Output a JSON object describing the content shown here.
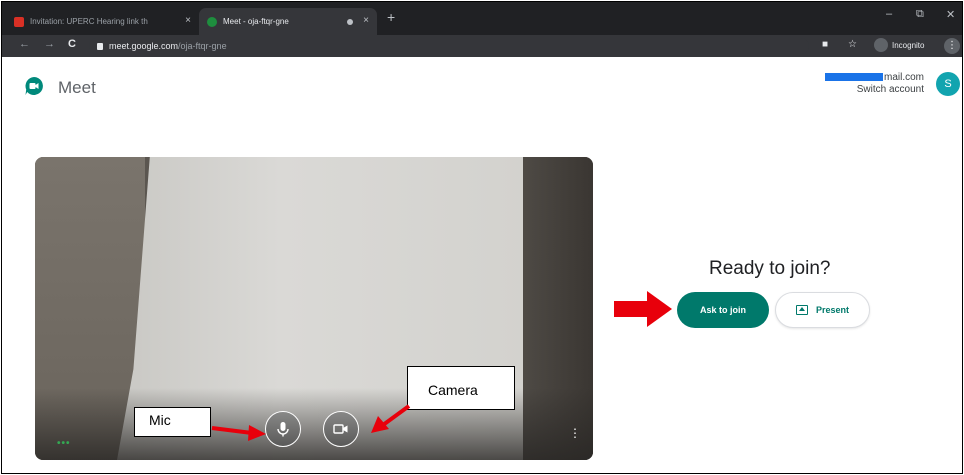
{
  "browser": {
    "tabs": [
      {
        "title": "Invitation: UPERC Hearing link th",
        "close": "×"
      },
      {
        "title": "Meet - oja-ftqr-gne",
        "close": "×"
      }
    ],
    "new_tab": "+",
    "window_controls": {
      "minimize": "–",
      "restore": "⧉",
      "close": "✕"
    },
    "nav": {
      "back": "←",
      "forward": "→",
      "reload": "C"
    },
    "url": {
      "host": "meet.google.com",
      "path": "/oja-ftqr-gne"
    },
    "icons": {
      "camera": "■",
      "star": "☆"
    },
    "incognito_label": "Incognito",
    "menu": "⋮"
  },
  "meet": {
    "app_name": "Meet",
    "account": {
      "email_visible": "mail.com",
      "switch_account": "Switch account",
      "avatar_letter": "S"
    },
    "ready_heading": "Ready to join?",
    "ask_to_join": "Ask to join",
    "present": "Present",
    "video_more": "⋮",
    "video_dots": "•••"
  },
  "annotations": {
    "mic": "Mic",
    "camera": "Camera"
  },
  "colors": {
    "accent": "#00796b",
    "arrow": "#e8000b",
    "avatar": "#12a4af",
    "chrome_dark": "#202124"
  }
}
